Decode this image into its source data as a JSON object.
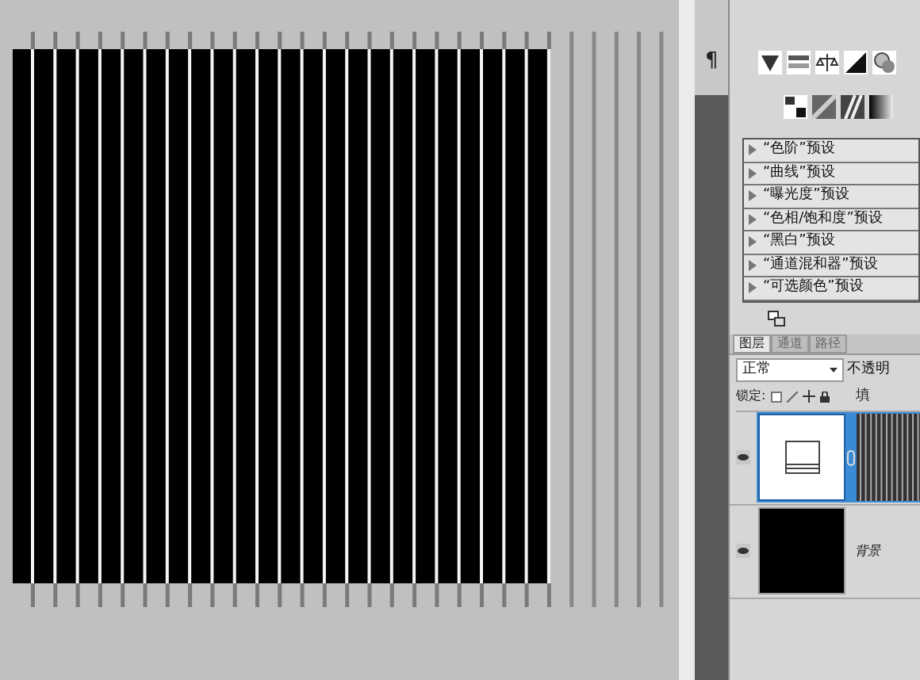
{
  "dock": {
    "paragraph_icon": "¶"
  },
  "adjustment_presets": [
    {
      "label": "“色阶”预设"
    },
    {
      "label": "“曲线”预设"
    },
    {
      "label": "“曝光度”预设"
    },
    {
      "label": "“色相/饱和度”预设"
    },
    {
      "label": "“黑白”预设"
    },
    {
      "label": "“通道混和器”预设"
    },
    {
      "label": "“可选颜色”预设"
    }
  ],
  "tabs": [
    {
      "label": "图层",
      "selected": true
    },
    {
      "label": "通道",
      "selected": false
    },
    {
      "label": "路径",
      "selected": false
    }
  ],
  "blend_mode": "正常",
  "opacity_label": "不透明",
  "lock_label": "锁定:",
  "fill_label": "填",
  "layers": [
    {
      "kind": "adjustment",
      "selected": true,
      "visible": true
    },
    {
      "kind": "image",
      "name": "背景",
      "selected": false,
      "visible": true
    }
  ]
}
